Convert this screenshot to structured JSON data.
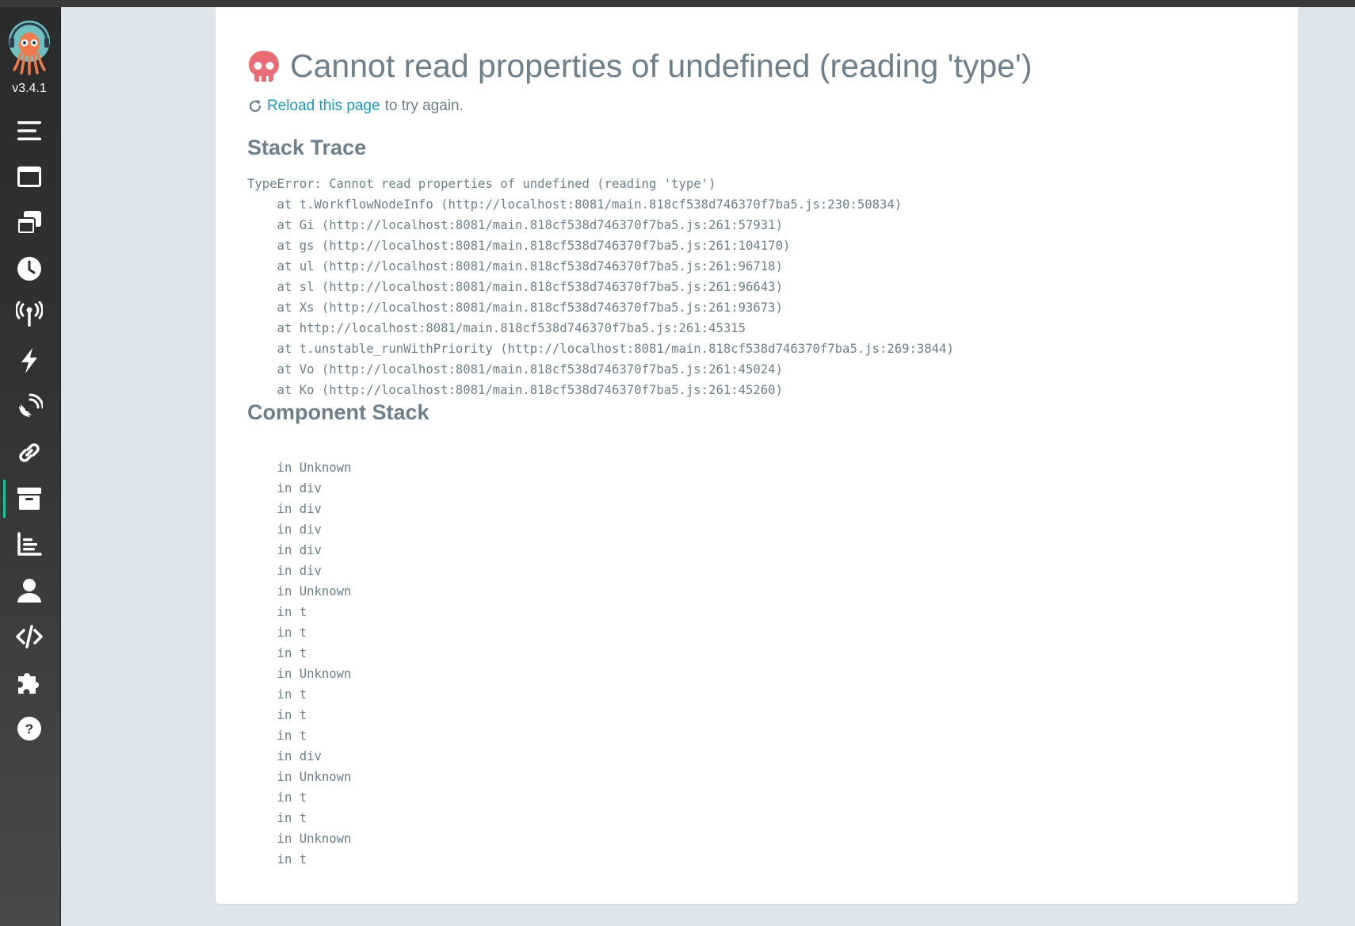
{
  "app": {
    "version": "v3.4.1"
  },
  "sidebar": {
    "items": [
      {
        "icon": "menu-icon",
        "label": ""
      },
      {
        "icon": "workflows-icon",
        "label": ""
      },
      {
        "icon": "workflow-templates-icon",
        "label": ""
      },
      {
        "icon": "cron-workflows-icon",
        "label": ""
      },
      {
        "icon": "event-sources-icon",
        "label": ""
      },
      {
        "icon": "sensors-icon",
        "label": ""
      },
      {
        "icon": "event-flow-icon",
        "label": ""
      },
      {
        "icon": "link-icon",
        "label": ""
      },
      {
        "icon": "archived-workflows-icon",
        "label": "",
        "active": true
      },
      {
        "icon": "reports-icon",
        "label": ""
      },
      {
        "icon": "user-icon",
        "label": ""
      },
      {
        "icon": "api-docs-icon",
        "label": ""
      },
      {
        "icon": "plugins-icon",
        "label": ""
      },
      {
        "icon": "help-icon",
        "label": ""
      }
    ]
  },
  "error": {
    "title": "Cannot read properties of undefined (reading 'type')",
    "reload_link": "Reload this page",
    "reload_suffix": "to try again.",
    "stack_trace_heading": "Stack Trace",
    "stack_trace": "TypeError: Cannot read properties of undefined (reading 'type')\n    at t.WorkflowNodeInfo (http://localhost:8081/main.818cf538d746370f7ba5.js:230:50834)\n    at Gi (http://localhost:8081/main.818cf538d746370f7ba5.js:261:57931)\n    at gs (http://localhost:8081/main.818cf538d746370f7ba5.js:261:104170)\n    at ul (http://localhost:8081/main.818cf538d746370f7ba5.js:261:96718)\n    at sl (http://localhost:8081/main.818cf538d746370f7ba5.js:261:96643)\n    at Xs (http://localhost:8081/main.818cf538d746370f7ba5.js:261:93673)\n    at http://localhost:8081/main.818cf538d746370f7ba5.js:261:45315\n    at t.unstable_runWithPriority (http://localhost:8081/main.818cf538d746370f7ba5.js:269:3844)\n    at Vo (http://localhost:8081/main.818cf538d746370f7ba5.js:261:45024)\n    at Ko (http://localhost:8081/main.818cf538d746370f7ba5.js:261:45260)",
    "component_stack_heading": "Component Stack",
    "component_stack": "\n    in Unknown\n    in div\n    in div\n    in div\n    in div\n    in div\n    in Unknown\n    in t\n    in t\n    in t\n    in Unknown\n    in t\n    in t\n    in t\n    in div\n    in Unknown\n    in t\n    in t\n    in Unknown\n    in t"
  },
  "colors": {
    "sidebar_bg": "#2b2b2b",
    "page_bg": "#dee6eb",
    "text": "#6d7f8b",
    "link": "#1a99ba",
    "error_icon": "#e96d76",
    "active_indicator": "#18be94"
  }
}
